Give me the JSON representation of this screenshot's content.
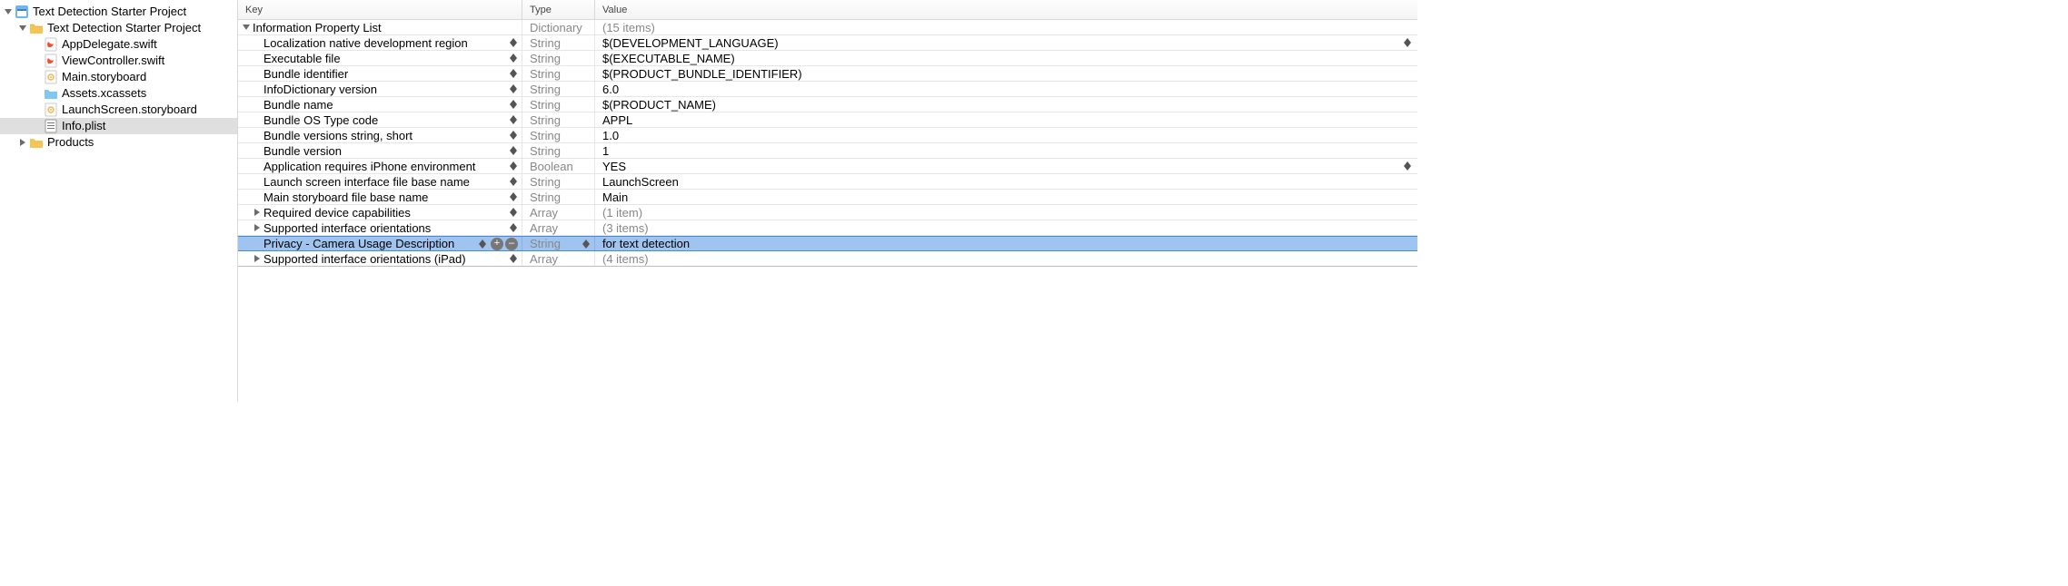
{
  "sidebar": {
    "root": {
      "label": "Text Detection Starter Project",
      "group": {
        "label": "Text Detection Starter Project",
        "files": [
          "AppDelegate.swift",
          "ViewController.swift",
          "Main.storyboard",
          "Assets.xcassets",
          "LaunchScreen.storyboard",
          "Info.plist"
        ]
      },
      "products_label": "Products"
    }
  },
  "plist": {
    "columns": {
      "key": "Key",
      "type": "Type",
      "value": "Value"
    },
    "root_key": "Information Property List",
    "root_type": "Dictionary",
    "root_value": "(15 items)",
    "rows": [
      {
        "key": "Localization native development region",
        "type": "String",
        "value": "$(DEVELOPMENT_LANGUAGE)",
        "val_stepper": true
      },
      {
        "key": "Executable file",
        "type": "String",
        "value": "$(EXECUTABLE_NAME)"
      },
      {
        "key": "Bundle identifier",
        "type": "String",
        "value": "$(PRODUCT_BUNDLE_IDENTIFIER)"
      },
      {
        "key": "InfoDictionary version",
        "type": "String",
        "value": "6.0"
      },
      {
        "key": "Bundle name",
        "type": "String",
        "value": "$(PRODUCT_NAME)"
      },
      {
        "key": "Bundle OS Type code",
        "type": "String",
        "value": "APPL"
      },
      {
        "key": "Bundle versions string, short",
        "type": "String",
        "value": "1.0"
      },
      {
        "key": "Bundle version",
        "type": "String",
        "value": "1"
      },
      {
        "key": "Application requires iPhone environment",
        "type": "Boolean",
        "value": "YES",
        "val_stepper": true
      },
      {
        "key": "Launch screen interface file base name",
        "type": "String",
        "value": "LaunchScreen"
      },
      {
        "key": "Main storyboard file base name",
        "type": "String",
        "value": "Main"
      },
      {
        "key": "Required device capabilities",
        "type": "Array",
        "value": "(1 item)",
        "disclosure": "right",
        "dim_value": true
      },
      {
        "key": "Supported interface orientations",
        "type": "Array",
        "value": "(3 items)",
        "disclosure": "right",
        "dim_value": true
      },
      {
        "key": "Privacy - Camera Usage Description",
        "type": "String",
        "value": "for text detection",
        "selected": true,
        "plusminus": true,
        "type_stepper": true
      },
      {
        "key": "Supported interface orientations (iPad)",
        "type": "Array",
        "value": "(4 items)",
        "disclosure": "right",
        "dim_value": true
      }
    ]
  }
}
